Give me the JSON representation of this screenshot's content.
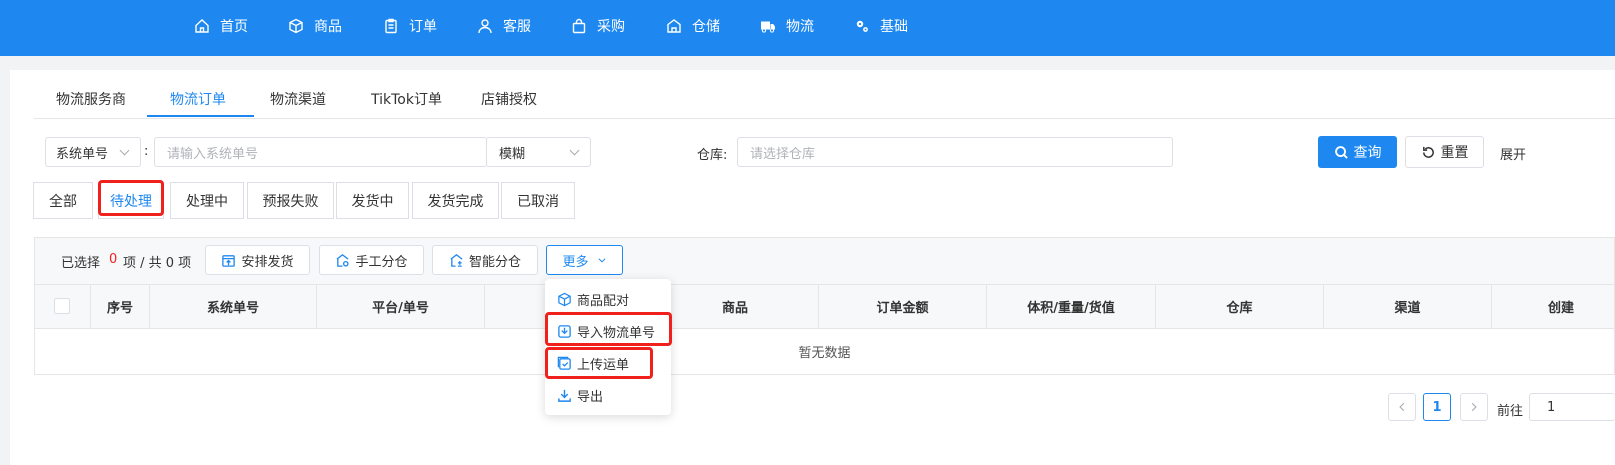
{
  "nav": {
    "items": [
      {
        "label": "首页",
        "icon": "home-icon"
      },
      {
        "label": "商品",
        "icon": "cube-icon"
      },
      {
        "label": "订单",
        "icon": "clipboard-icon"
      },
      {
        "label": "客服",
        "icon": "user-icon"
      },
      {
        "label": "采购",
        "icon": "bag-icon"
      },
      {
        "label": "仓储",
        "icon": "warehouse-icon"
      },
      {
        "label": "物流",
        "icon": "truck-icon"
      },
      {
        "label": "基础",
        "icon": "gears-icon"
      }
    ]
  },
  "tabs": {
    "items": [
      "物流服务商",
      "物流订单",
      "物流渠道",
      "TikTok订单",
      "店铺授权"
    ],
    "active": "物流订单"
  },
  "filter": {
    "field_select": "系统单号",
    "colon": ":",
    "search_placeholder": "请输入系统单号",
    "match_select": "模糊",
    "warehouse_label": "仓库:",
    "warehouse_placeholder": "请选择仓库",
    "query_label": "查询",
    "reset_label": "重置",
    "expand_label": "展开"
  },
  "status_tabs": {
    "items": [
      "全部",
      "待处理",
      "处理中",
      "预报失败",
      "发货中",
      "发货完成",
      "已取消"
    ],
    "active": "待处理"
  },
  "toolbar": {
    "selected_prefix": "已选择",
    "selected_count": "0",
    "selected_suffix": "项 / 共 0 项",
    "arrange_label": "安排发货",
    "manual_label": "手工分仓",
    "smart_label": "智能分仓",
    "more_label": "更多"
  },
  "table": {
    "columns": [
      "序号",
      "系统单号",
      "平台/单号",
      "收",
      "商品",
      "订单金额",
      "体积/重量/货值",
      "仓库",
      "渠道",
      "创建"
    ],
    "empty_text": "暂无数据"
  },
  "dropdown": {
    "items": [
      "商品配对",
      "导入物流单号",
      "上传运单",
      "导出"
    ]
  },
  "pagination": {
    "current": "1",
    "goto_label": "前往",
    "goto_value": "1"
  },
  "colors": {
    "brand": "#1e88f0",
    "highlight": "#f0211d"
  }
}
